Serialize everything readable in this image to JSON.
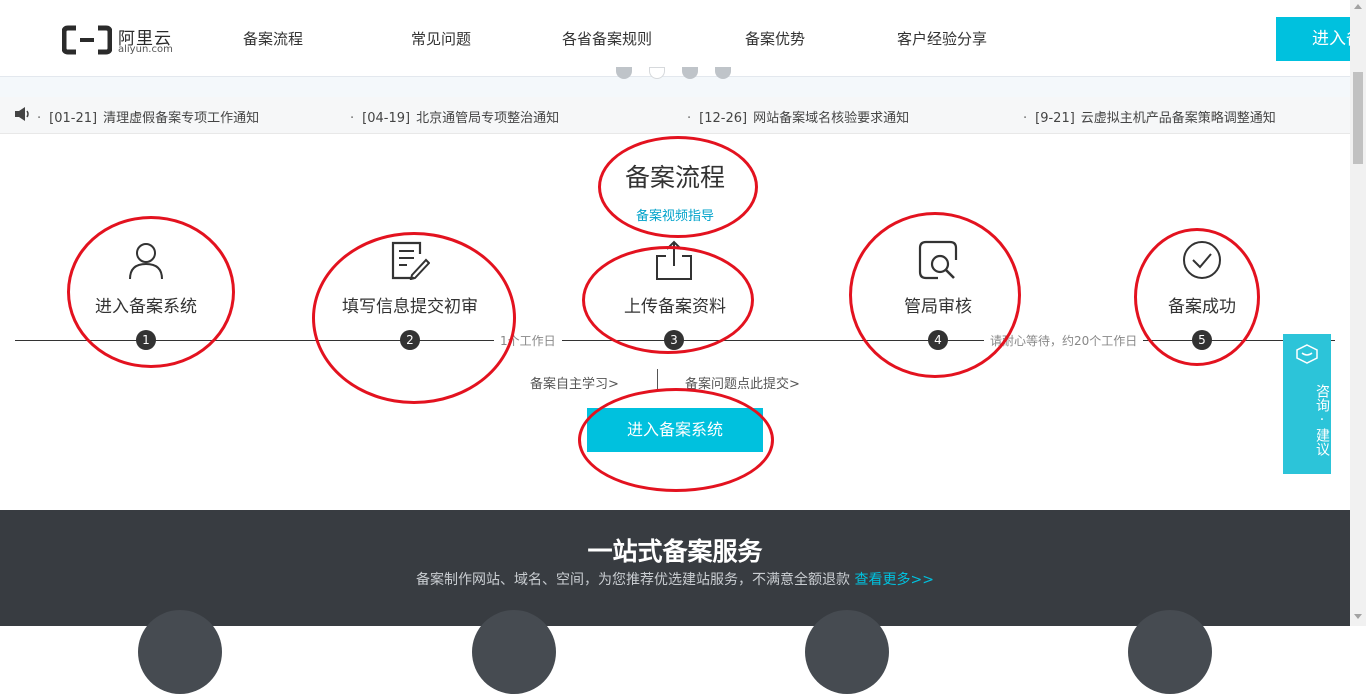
{
  "header": {
    "logo_cn": "阿里云",
    "logo_en": "aliyun.com",
    "nav": [
      "备案流程",
      "常见问题",
      "各省备案规则",
      "备案优势",
      "客户经验分享"
    ],
    "enter_button": "进入备"
  },
  "notices": [
    {
      "date": "[01-21]",
      "text": "清理虚假备案专项工作通知"
    },
    {
      "date": "[04-19]",
      "text": "北京通管局专项整治通知"
    },
    {
      "date": "[12-26]",
      "text": "网站备案域名核验要求通知"
    },
    {
      "date": "[9-21]",
      "text": "云虚拟主机产品备案策略调整通知"
    }
  ],
  "process": {
    "title": "备案流程",
    "video_link": "备案视频指导",
    "steps": [
      {
        "num": "1",
        "label": "进入备案系统",
        "icon": "user-icon"
      },
      {
        "num": "2",
        "label": "填写信息提交初审",
        "icon": "edit-form-icon"
      },
      {
        "num": "3",
        "label": "上传备案资料",
        "icon": "upload-icon"
      },
      {
        "num": "4",
        "label": "管局审核",
        "icon": "search-review-icon"
      },
      {
        "num": "5",
        "label": "备案成功",
        "icon": "check-circle-icon"
      }
    ],
    "gap_1": "1个工作日",
    "gap_2": "请耐心等待，约20个工作日",
    "self_learn_link": "备案自主学习>",
    "feedback_link": "备案问题点此提交>",
    "enter_button": "进入备案系统"
  },
  "consult": {
    "label": "咨询·建议"
  },
  "services": {
    "title": "一站式备案服务",
    "subtitle": "备案制作网站、域名、空间，为您推荐优选建站服务，不满意全额退款",
    "more_link": "查看更多>>"
  },
  "colors": {
    "accent": "#00c1de",
    "annotation": "#e3121f",
    "dark_band": "#383c41"
  }
}
